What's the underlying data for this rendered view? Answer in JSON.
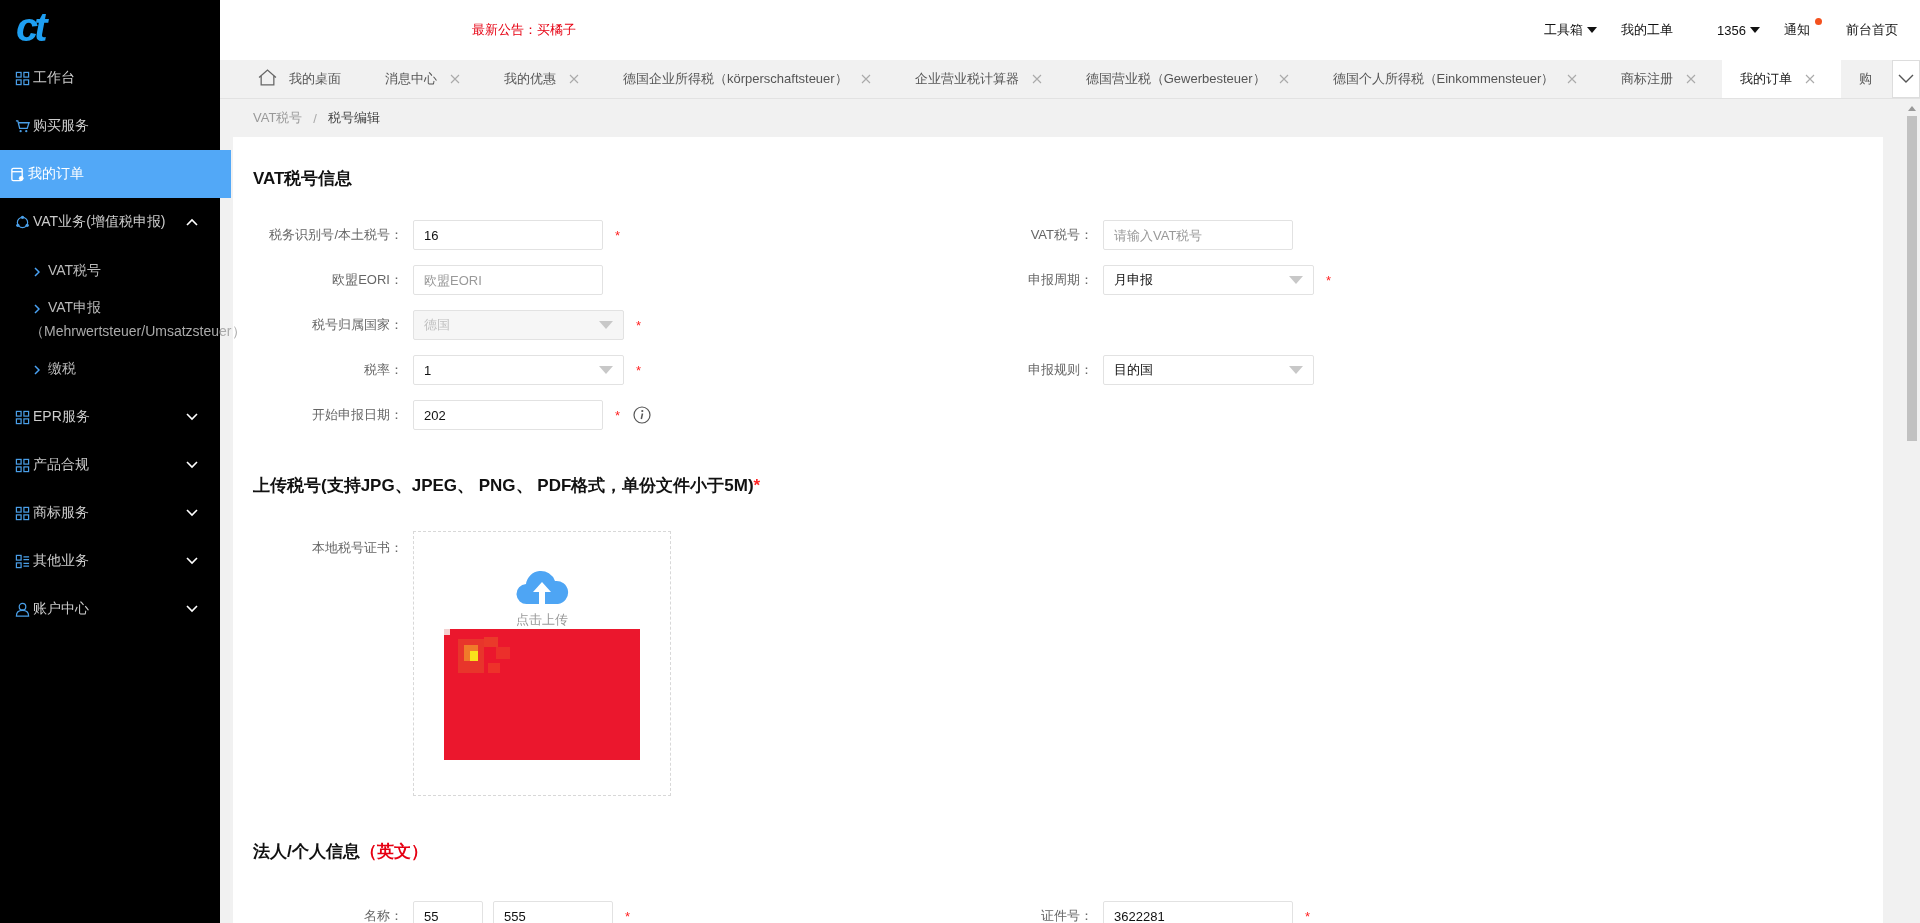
{
  "logo": {
    "text": "ct"
  },
  "announcement": "最新公告：买橘子",
  "top_nav": [
    {
      "label": "工具箱",
      "dropdown": true,
      "badge": false
    },
    {
      "label": "我的工单",
      "dropdown": false,
      "badge": false
    },
    {
      "label": "1356",
      "dropdown": true,
      "badge": false
    },
    {
      "label": "通知",
      "dropdown": false,
      "badge": true
    },
    {
      "label": "前台首页",
      "dropdown": false,
      "badge": false
    }
  ],
  "sidebar": {
    "items": [
      {
        "kind": "link",
        "label": "工作台",
        "selected": false
      },
      {
        "kind": "link",
        "label": "购买服务",
        "selected": false
      },
      {
        "kind": "link",
        "label": "我的订单",
        "selected": true
      },
      {
        "kind": "group",
        "label": "VAT业务(增值税申报)",
        "selected": false,
        "expanded": true,
        "children": [
          {
            "label": "VAT税号"
          },
          {
            "label": "VAT申报",
            "note": "（Mehrwertsteuer/Umsatzsteuer）"
          },
          {
            "label": "缴税"
          }
        ]
      },
      {
        "kind": "group",
        "label": "EPR服务",
        "selected": false,
        "expanded": false
      },
      {
        "kind": "group",
        "label": "产品合规",
        "selected": false,
        "expanded": false
      },
      {
        "kind": "group",
        "label": "商标服务",
        "selected": false,
        "expanded": false
      },
      {
        "kind": "group",
        "label": "其他业务",
        "selected": false,
        "expanded": false
      },
      {
        "kind": "group",
        "label": "账户中心",
        "selected": false,
        "expanded": false
      }
    ]
  },
  "tabs": [
    {
      "label": "我的桌面",
      "home": true,
      "closable": false,
      "selected": false
    },
    {
      "label": "消息中心",
      "home": false,
      "closable": true,
      "selected": false
    },
    {
      "label": "我的优惠",
      "home": false,
      "closable": true,
      "selected": false
    },
    {
      "label": "德国企业所得税（körperschaftsteuer）",
      "home": false,
      "closable": true,
      "selected": false
    },
    {
      "label": "企业营业税计算器",
      "home": false,
      "closable": true,
      "selected": false
    },
    {
      "label": "德国营业税（Gewerbesteuer）",
      "home": false,
      "closable": true,
      "selected": false
    },
    {
      "label": "德国个人所得税（Einkommensteuer）",
      "home": false,
      "closable": true,
      "selected": false
    },
    {
      "label": "商标注册",
      "home": false,
      "closable": true,
      "selected": false
    },
    {
      "label": "我的订单",
      "home": false,
      "closable": true,
      "selected": true
    },
    {
      "label": "购",
      "home": false,
      "closable": false,
      "selected": false
    }
  ],
  "breadcrumb": {
    "items": [
      "VAT税号",
      "税号编辑"
    ],
    "separator": "/"
  },
  "tax_section": {
    "title": "VAT税号信息",
    "rows": [
      {
        "left": {
          "kind": "input",
          "label": "税务识别号/本土税号：",
          "value": "16",
          "required_mark": "*",
          "info": false
        },
        "right": {
          "kind": "input",
          "label": "VAT税号：",
          "placeholder": "请输入VAT税号",
          "info": false
        }
      },
      {
        "left": {
          "kind": "input",
          "label": "欧盟EORI：",
          "placeholder": "欧盟EORI",
          "info": false
        },
        "right": {
          "kind": "select",
          "label": "申报周期：",
          "value": "月申报",
          "required_mark": "*",
          "disabled": false,
          "info": false
        }
      },
      {
        "left": {
          "kind": "select",
          "label": "税号归属国家：",
          "value": "德国",
          "required_mark": "*",
          "disabled": true,
          "info": false
        }
      },
      {
        "left": {
          "kind": "select",
          "label": "税率：",
          "value": "1",
          "required_mark": "*",
          "disabled": false,
          "info": false
        },
        "right": {
          "kind": "select",
          "label": "申报规则：",
          "value": "目的国",
          "disabled": false,
          "info": false
        }
      },
      {
        "left": {
          "kind": "input",
          "label": "开始申报日期：",
          "value": "202",
          "required_mark": "*",
          "info": true
        }
      }
    ]
  },
  "upload_section": {
    "title": "上传税号(支持JPG、JPEG、 PNG、 PDF格式，单份文件小于5M)",
    "required_mark": "*",
    "label": "本地税号证书：",
    "button": "点击上传"
  },
  "person_section": {
    "title": "法人/个人信息",
    "note": "（英文）",
    "name_label": "名称：",
    "name_values": [
      "55",
      "555"
    ],
    "name_required_mark": "*",
    "id_label": "证件号：",
    "id_value": "3622281",
    "id_required_mark": "*"
  }
}
